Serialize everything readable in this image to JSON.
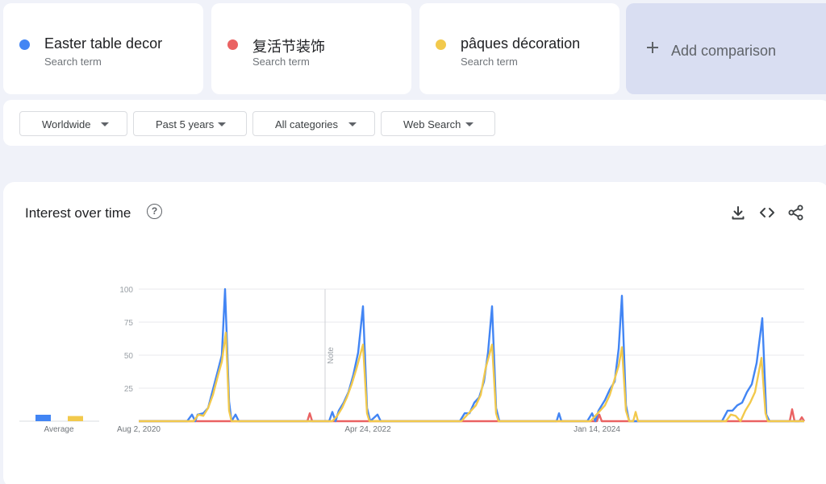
{
  "terms": [
    {
      "name": "Easter table decor",
      "subtitle": "Search term",
      "color": "#4285f4"
    },
    {
      "name": "复活节装饰",
      "subtitle": "Search term",
      "color": "#ea6262"
    },
    {
      "name": "pâques décoration",
      "subtitle": "Search term",
      "color": "#f2c94c"
    }
  ],
  "add_comparison": {
    "label": "Add comparison"
  },
  "filters": {
    "region": "Worldwide",
    "time_range": "Past 5 years",
    "category": "All categories",
    "search_type": "Web Search"
  },
  "panel": {
    "title": "Interest over time",
    "help_icon": "question-circle-icon",
    "download_icon": "download-icon",
    "embed_icon": "code-icon",
    "share_icon": "share-icon"
  },
  "chart_data": {
    "type": "line",
    "title": "",
    "ylim": [
      0,
      100
    ],
    "yticks": [
      25,
      50,
      75,
      100
    ],
    "x_tick_labels": [
      "Aug 2, 2020",
      "Apr 24, 2022",
      "Jan 14, 2024"
    ],
    "note_label": "Note",
    "average_label": "Average",
    "grid": true,
    "series": [
      {
        "name": "Easter table decor",
        "color": "#4285f4",
        "average": 5,
        "peaks": [
          {
            "x": 279,
            "y": 100,
            "before": [
              [
                232,
                0
              ],
              [
                238,
                5
              ],
              [
                242,
                0
              ],
              [
                245,
                5
              ],
              [
                252,
                6
              ],
              [
                258,
                10
              ],
              [
                264,
                24
              ],
              [
                270,
                38
              ],
              [
                275,
                50
              ]
            ],
            "after": [
              [
                284,
                15
              ],
              [
                287,
                0
              ],
              [
                292,
                5
              ],
              [
                296,
                0
              ]
            ]
          },
          {
            "x": 450,
            "y": 87,
            "before": [
              [
                408,
                0
              ],
              [
                412,
                7
              ],
              [
                416,
                0
              ],
              [
                420,
                8
              ],
              [
                426,
                14
              ],
              [
                432,
                22
              ],
              [
                438,
                35
              ],
              [
                444,
                52
              ]
            ],
            "after": [
              [
                455,
                10
              ],
              [
                459,
                0
              ],
              [
                468,
                5
              ],
              [
                472,
                0
              ]
            ]
          },
          {
            "x": 610,
            "y": 87,
            "before": [
              [
                570,
                0
              ],
              [
                576,
                6
              ],
              [
                582,
                6
              ],
              [
                588,
                14
              ],
              [
                594,
                18
              ],
              [
                600,
                30
              ],
              [
                605,
                52
              ]
            ],
            "after": [
              [
                615,
                10
              ],
              [
                619,
                0
              ],
              [
                690,
                0
              ],
              [
                693,
                6
              ],
              [
                696,
                0
              ]
            ]
          },
          {
            "x": 771,
            "y": 95,
            "before": [
              [
                728,
                0
              ],
              [
                734,
                6
              ],
              [
                738,
                0
              ],
              [
                742,
                8
              ],
              [
                750,
                16
              ],
              [
                756,
                24
              ],
              [
                762,
                30
              ],
              [
                767,
                55
              ]
            ],
            "after": [
              [
                776,
                12
              ],
              [
                780,
                0
              ]
            ]
          },
          {
            "x": 945,
            "y": 78,
            "before": [
              [
                895,
                0
              ],
              [
                902,
                8
              ],
              [
                908,
                8
              ],
              [
                914,
                12
              ],
              [
                920,
                14
              ],
              [
                926,
                22
              ],
              [
                932,
                28
              ],
              [
                938,
                44
              ]
            ],
            "after": [
              [
                950,
                5
              ],
              [
                954,
                0
              ]
            ]
          }
        ]
      },
      {
        "name": "复活节装饰",
        "color": "#ea6262",
        "average": 0,
        "spikes": [
          [
            384,
            6
          ],
          [
            743,
            5
          ],
          [
            982,
            9
          ],
          [
            994,
            3
          ]
        ]
      },
      {
        "name": "pâques décoration",
        "color": "#f2c94c",
        "average": 4,
        "peaks": [
          {
            "x": 280,
            "y": 67,
            "before": [
              [
                240,
                0
              ],
              [
                246,
                5
              ],
              [
                252,
                4
              ],
              [
                258,
                10
              ],
              [
                264,
                20
              ],
              [
                270,
                34
              ],
              [
                275,
                45
              ]
            ],
            "after": [
              [
                284,
                8
              ],
              [
                287,
                0
              ]
            ]
          },
          {
            "x": 450,
            "y": 58,
            "before": [
              [
                412,
                0
              ],
              [
                418,
                4
              ],
              [
                424,
                10
              ],
              [
                430,
                18
              ],
              [
                436,
                28
              ],
              [
                442,
                40
              ]
            ],
            "after": [
              [
                455,
                6
              ],
              [
                458,
                0
              ]
            ]
          },
          {
            "x": 610,
            "y": 58,
            "before": [
              [
                572,
                0
              ],
              [
                578,
                4
              ],
              [
                584,
                8
              ],
              [
                590,
                12
              ],
              [
                596,
                20
              ],
              [
                602,
                40
              ]
            ],
            "after": [
              [
                615,
                6
              ],
              [
                618,
                0
              ]
            ]
          },
          {
            "x": 771,
            "y": 56,
            "before": [
              [
                732,
                0
              ],
              [
                738,
                4
              ],
              [
                744,
                8
              ],
              [
                750,
                12
              ],
              [
                756,
                20
              ],
              [
                762,
                32
              ],
              [
                767,
                42
              ]
            ],
            "after": [
              [
                776,
                8
              ],
              [
                780,
                0
              ],
              [
                785,
                0
              ],
              [
                788,
                7
              ],
              [
                791,
                0
              ]
            ]
          },
          {
            "x": 944,
            "y": 48,
            "before": [
              [
                900,
                0
              ],
              [
                906,
                5
              ],
              [
                912,
                4
              ],
              [
                918,
                0
              ],
              [
                924,
                8
              ],
              [
                930,
                14
              ],
              [
                936,
                22
              ],
              [
                940,
                35
              ]
            ],
            "after": [
              [
                949,
                6
              ],
              [
                952,
                0
              ]
            ]
          }
        ]
      }
    ]
  }
}
